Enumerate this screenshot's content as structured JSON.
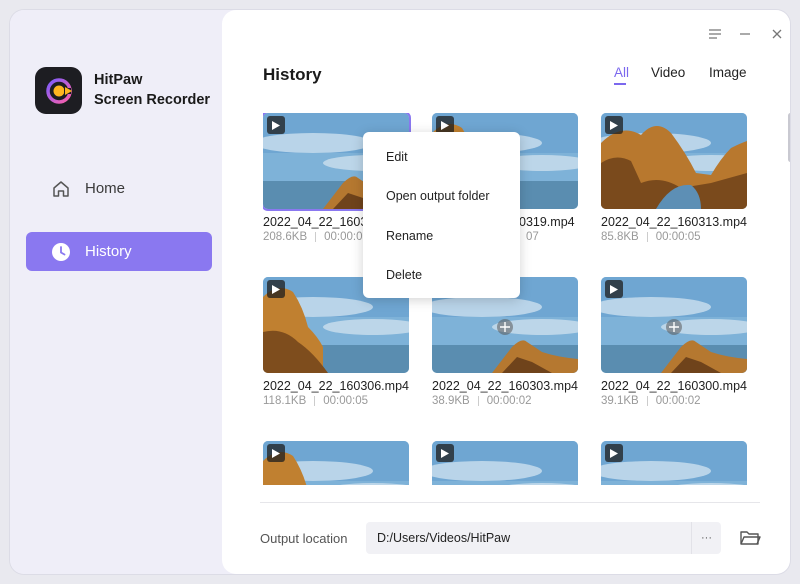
{
  "app": {
    "brand_line1": "HitPaw",
    "brand_line2": "Screen Recorder"
  },
  "sidebar": {
    "items": [
      {
        "label": "Home",
        "icon": "home-icon",
        "active": false
      },
      {
        "label": "History",
        "icon": "clock-icon",
        "active": true
      }
    ]
  },
  "header": {
    "title": "History",
    "tabs": [
      {
        "label": "All",
        "active": true
      },
      {
        "label": "Video",
        "active": false
      },
      {
        "label": "Image",
        "active": false
      }
    ]
  },
  "files": [
    {
      "name": "2022_04_22_16033",
      "size": "208.6KB",
      "duration": "00:00:0",
      "selected": true
    },
    {
      "name": "0319.mp4",
      "size": "",
      "duration": "07",
      "selected": false
    },
    {
      "name": "2022_04_22_160313.mp4",
      "size": "85.8KB",
      "duration": "00:00:05",
      "selected": false
    },
    {
      "name": "2022_04_22_160306.mp4",
      "size": "118.1KB",
      "duration": "00:00:05",
      "selected": false
    },
    {
      "name": "2022_04_22_160303.mp4",
      "size": "38.9KB",
      "duration": "00:00:02",
      "selected": false
    },
    {
      "name": "2022_04_22_160300.mp4",
      "size": "39.1KB",
      "duration": "00:00:02",
      "selected": false
    },
    {
      "name": "",
      "size": "",
      "duration": "",
      "selected": false
    },
    {
      "name": "",
      "size": "",
      "duration": "",
      "selected": false
    },
    {
      "name": "",
      "size": "",
      "duration": "",
      "selected": false
    }
  ],
  "context_menu": {
    "items": [
      "Edit",
      "Open output folder",
      "Rename",
      "Delete"
    ]
  },
  "footer": {
    "output_label": "Output location",
    "output_path": "D:/Users/Videos/HitPaw",
    "more_label": "···"
  },
  "colors": {
    "accent": "#8a78f0",
    "tab_active": "#7b68ee"
  }
}
